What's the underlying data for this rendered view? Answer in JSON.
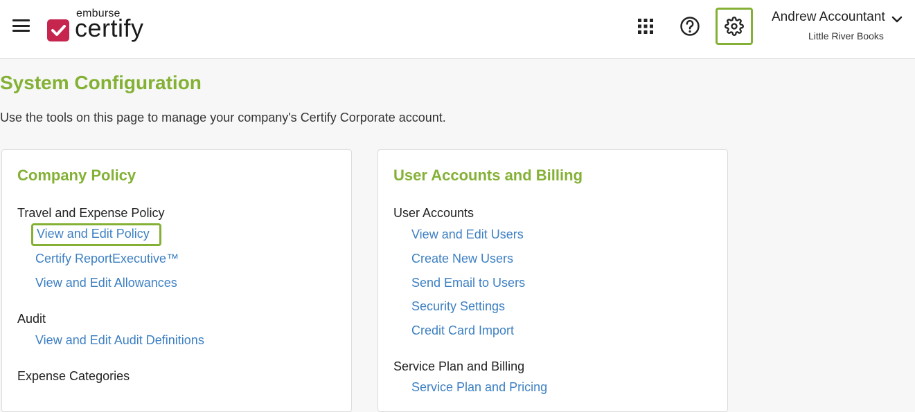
{
  "header": {
    "logo_small": "emburse",
    "logo_big": "certify",
    "user_name": "Andrew Accountant",
    "user_company": "Little River Books"
  },
  "colors": {
    "accent": "#84b135",
    "link": "#3c7fc2",
    "brand": "#c6254e"
  },
  "icons": [
    "menu-icon",
    "apps-grid-icon",
    "help-icon",
    "gear-icon",
    "chevron-down-icon",
    "checkmark-icon"
  ],
  "main": {
    "title": "System Configuration",
    "description": "Use the tools on this page to manage your company's Certify Corporate account."
  },
  "company_policy": {
    "title": "Company Policy",
    "sections": [
      {
        "title": "Travel and Expense Policy",
        "links": [
          "View and Edit Policy",
          "Certify ReportExecutive™",
          "View and Edit Allowances"
        ]
      },
      {
        "title": "Audit",
        "links": [
          "View and Edit Audit Definitions"
        ]
      },
      {
        "title": "Expense Categories",
        "links": []
      }
    ]
  },
  "user_accounts": {
    "title": "User Accounts and Billing",
    "sections": [
      {
        "title": "User Accounts",
        "links": [
          "View and Edit Users",
          "Create New Users",
          "Send Email to Users",
          "Security Settings",
          "Credit Card Import"
        ]
      },
      {
        "title": "Service Plan and Billing",
        "links": [
          "Service Plan and Pricing"
        ]
      }
    ]
  }
}
